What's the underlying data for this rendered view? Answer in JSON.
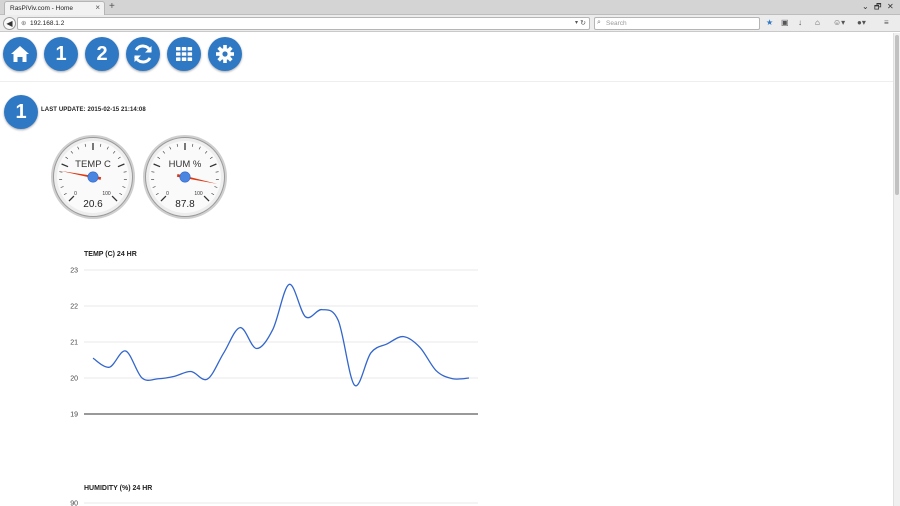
{
  "browser": {
    "tab_title": "RasPiViv.com - Home",
    "tab_close": "×",
    "new_tab": "+",
    "url": "192.168.1.2",
    "search_placeholder": "Search",
    "window_controls": [
      "⌄",
      "🗗",
      "✕"
    ]
  },
  "nav": {
    "buttons": [
      {
        "name": "home",
        "icon": "home-icon",
        "label": ""
      },
      {
        "name": "sensor-1",
        "icon": "",
        "label": "1"
      },
      {
        "name": "sensor-2",
        "icon": "",
        "label": "2"
      },
      {
        "name": "refresh",
        "icon": "refresh-icon",
        "label": ""
      },
      {
        "name": "grid",
        "icon": "grid-icon",
        "label": ""
      },
      {
        "name": "settings",
        "icon": "gear-icon",
        "label": ""
      }
    ]
  },
  "section": {
    "badge": "1",
    "last_update": "LAST UPDATE: 2015-02-15 21:14:08"
  },
  "gauges": [
    {
      "label": "TEMP C",
      "value": 20.6,
      "value_text": "20.6",
      "min": "0",
      "max": "100"
    },
    {
      "label": "HUM %",
      "value": 87.8,
      "value_text": "87.8",
      "min": "0",
      "max": "100"
    }
  ],
  "chart_data": [
    {
      "type": "line",
      "title": "TEMP (C) 24 HR",
      "xlabel": "",
      "ylabel": "",
      "ylim": [
        19,
        23
      ],
      "yticks": [
        "23",
        "22",
        "21",
        "20",
        "19"
      ],
      "grid": true,
      "series": [
        {
          "color": "#3366cc",
          "x": [
            0,
            1,
            2,
            3,
            4,
            5,
            6,
            7,
            8,
            9,
            10,
            11,
            12,
            13,
            14,
            15,
            16,
            17,
            18,
            19,
            20,
            21,
            22,
            23
          ],
          "values": [
            20.55,
            20.3,
            20.75,
            20.0,
            19.98,
            20.05,
            20.18,
            19.97,
            20.7,
            21.4,
            20.82,
            21.35,
            22.6,
            21.7,
            21.9,
            21.6,
            19.8,
            20.7,
            20.95,
            21.15,
            20.85,
            20.2,
            19.98,
            20.0
          ]
        }
      ]
    },
    {
      "type": "line",
      "title": "HUMIDITY (%) 24 HR",
      "yticks": [
        "90"
      ]
    }
  ]
}
